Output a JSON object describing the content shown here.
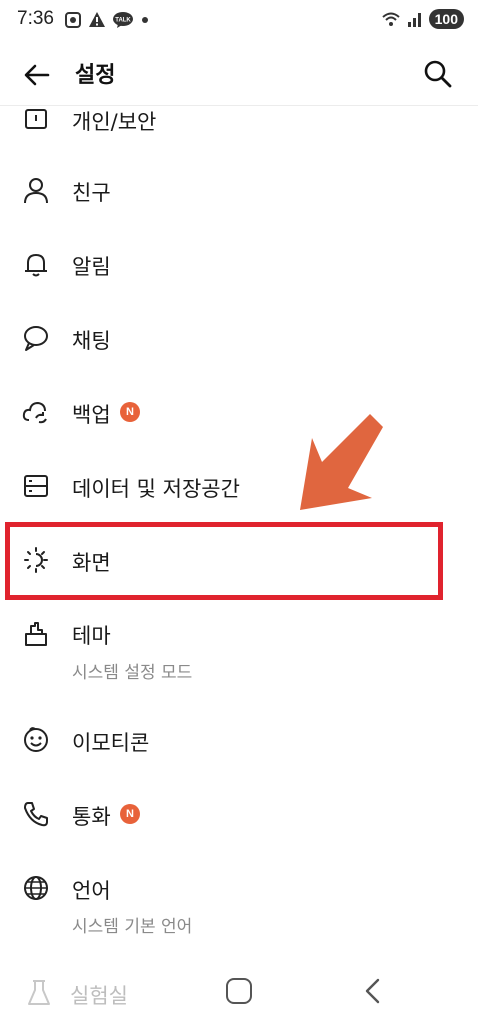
{
  "status_bar": {
    "time": "7:36",
    "battery": "100",
    "icons": [
      "screenshot-icon",
      "warning-icon",
      "talk-icon",
      "dot-icon",
      "wifi-icon",
      "signal-icon"
    ]
  },
  "header": {
    "title": "설정",
    "back_icon": "back-arrow-icon",
    "search_icon": "search-icon"
  },
  "menu": {
    "items": [
      {
        "label": "개인/보안",
        "icon": "lock-icon"
      },
      {
        "label": "친구",
        "icon": "person-icon"
      },
      {
        "label": "알림",
        "icon": "bell-icon"
      },
      {
        "label": "채팅",
        "icon": "chat-bubble-icon"
      },
      {
        "label": "백업",
        "icon": "cloud-sync-icon",
        "badge": "N"
      },
      {
        "label": "데이터 및 저장공간",
        "icon": "storage-icon"
      },
      {
        "label": "화면",
        "icon": "brightness-icon"
      },
      {
        "label": "테마",
        "icon": "theme-brush-icon",
        "sub": "시스템 설정 모드"
      },
      {
        "label": "이모티콘",
        "icon": "emoticon-icon"
      },
      {
        "label": "통화",
        "icon": "phone-icon",
        "badge": "N"
      },
      {
        "label": "언어",
        "icon": "globe-icon",
        "sub": "시스템 기본 언어"
      }
    ]
  },
  "nav": {
    "lab_label": "실험실",
    "lab_icon": "flask-icon",
    "home_icon": "home-icon",
    "back_icon": "nav-back-icon"
  },
  "annotation": {
    "highlight_color": "#e0232e",
    "arrow_color": "#e0663f"
  }
}
